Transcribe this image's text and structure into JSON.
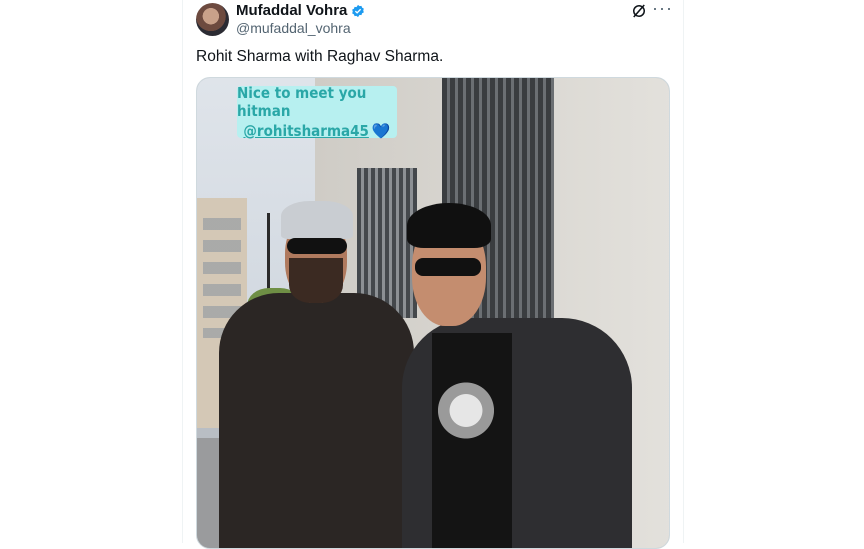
{
  "tweet": {
    "author_name": "Mufaddal Vohra",
    "handle": "@mufaddal_vohra",
    "text": "Rohit Sharma with Raghav Sharma.",
    "verified_icon": "verified-badge-icon",
    "grok_icon": "grok-icon",
    "more_label": "···"
  },
  "media": {
    "sticker_line1": "Nice to meet you hitman",
    "sticker_line2": "@rohitsharma45",
    "sticker_emoji": "💙"
  },
  "colors": {
    "verified": "#1d9bf0",
    "sticker_bg": "#b7f0f0",
    "sticker_text": "#2aa7a7"
  }
}
